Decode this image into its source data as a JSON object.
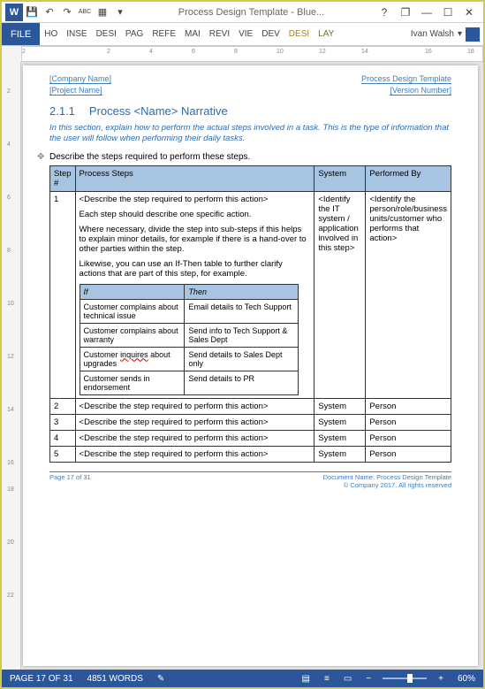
{
  "titlebar": {
    "app_initial": "W",
    "doc_title": "Process Design Template - Blue...",
    "help_icon": "?",
    "restore_icon": "❐",
    "min_icon": "—",
    "max_icon": "☐",
    "close_icon": "✕",
    "save_icon": "💾",
    "undo_icon": "↶",
    "redo_icon": "↷",
    "spell_icon": "ABC",
    "table_icon": "▦",
    "more_icon": "▾"
  },
  "ribbon": {
    "file": "FILE",
    "tabs": [
      "HO",
      "INSE",
      "DESI",
      "PAG",
      "REFE",
      "MAI",
      "REVI",
      "VIE",
      "DEV"
    ],
    "ctx_tabs": [
      "DESI",
      "LAY"
    ],
    "user": "Ivan Walsh",
    "user_drop": "▾"
  },
  "ruler": {
    "h": [
      "2",
      "",
      "",
      "",
      "2",
      "",
      "4",
      "",
      "6",
      "",
      "8",
      "",
      "10",
      "",
      "12",
      "",
      "14",
      "",
      "",
      "16",
      "",
      "18"
    ],
    "v": [
      "",
      "2",
      "",
      "4",
      "",
      "6",
      "",
      "8",
      "",
      "10",
      "",
      "12",
      "",
      "14",
      "",
      "16",
      "18",
      "",
      "20",
      "",
      "22",
      ""
    ]
  },
  "doc": {
    "hdr_company": "[Company Name]",
    "hdr_project": "[Project Name]",
    "hdr_template": "Process Design Template",
    "hdr_version": "[Version Number]",
    "heading_num": "2.1.1",
    "heading_text": "Process <Name> Narrative",
    "intro": "In this section, explain how to perform the actual steps involved in a task. This is the type of information that the user will follow when performing their daily tasks.",
    "desc": "Describe the steps required to perform these steps.",
    "cols": {
      "step": "Step #",
      "process": "Process Steps",
      "system": "System",
      "perf": "Performed By"
    },
    "row1": {
      "num": "1",
      "p1": "<Describe the step required to perform this action>",
      "p2": "Each step should describe one specific action.",
      "p3": "Where necessary, divide the step into sub-steps if this helps to explain minor details, for example if there is a hand-over to other parties within the step.",
      "p4": "Likewise, you can use an If-Then table to further clarify actions that are part of this step, for example.",
      "sys": "<Identify the IT system / application involved in this step>",
      "perf": "<Identify the person/role/business units/customer who performs that action>"
    },
    "ifthen": {
      "if": "If",
      "then": "Then",
      "rows": [
        {
          "if": "Customer complains about technical issue",
          "then": "Email details to Tech Support"
        },
        {
          "if": "Customer complains about warranty",
          "then": "Send info to Tech Support & Sales Dept"
        },
        {
          "if_pre": "Customer ",
          "if_wavy": "inquires",
          "if_post": " about upgrades",
          "then": "Send details to Sales Dept only"
        },
        {
          "if": "Customer sends in endorsement",
          "then": "Send details to PR"
        }
      ]
    },
    "rows_rest": [
      {
        "num": "2",
        "p": "<Describe the step required to perform this action>",
        "sys": "System",
        "perf": "Person"
      },
      {
        "num": "3",
        "p": "<Describe the step required to perform this action>",
        "sys": "System",
        "perf": "Person"
      },
      {
        "num": "4",
        "p": "<Describe the step required to perform this action>",
        "sys": "System",
        "perf": "Person"
      },
      {
        "num": "5",
        "p": "<Describe the step required to perform this action>",
        "sys": "System",
        "perf": "Person"
      }
    ],
    "ftr_page": "Page 17 of 31",
    "ftr_doc": "Document Name: Process Design Template",
    "ftr_copy": "© Company 2017. All rights reserved"
  },
  "status": {
    "page": "PAGE 17 OF 31",
    "words": "4851 WORDS",
    "proof": "✎",
    "view1": "▤",
    "view2": "≡",
    "view3": "▭",
    "minus": "−",
    "plus": "+",
    "zoom": "60%"
  }
}
